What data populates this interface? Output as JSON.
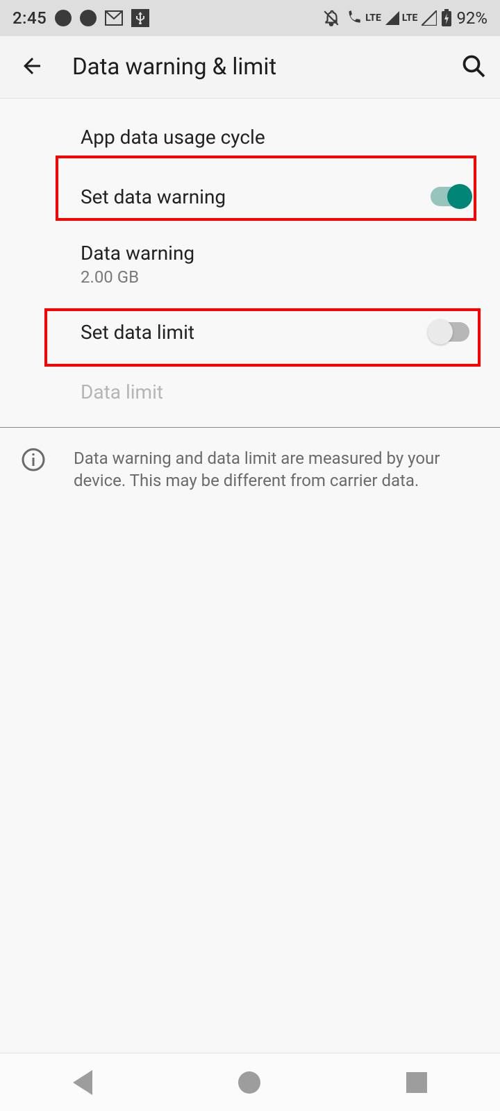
{
  "status": {
    "time": "2:45",
    "battery_pct": "92%",
    "lte_label": "LTE"
  },
  "header": {
    "title": "Data warning & limit"
  },
  "rows": {
    "cycle_label": "App data usage cycle",
    "set_warning_label": "Set data warning",
    "set_warning_on": true,
    "data_warning_label": "Data warning",
    "data_warning_value": "2.00 GB",
    "set_limit_label": "Set data limit",
    "set_limit_on": false,
    "data_limit_label": "Data limit"
  },
  "info": {
    "text": "Data warning and data limit are measured by your device. This may be different from carrier data."
  }
}
